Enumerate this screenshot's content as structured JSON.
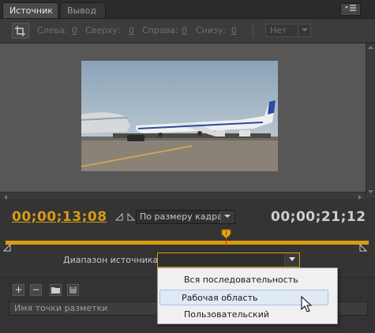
{
  "tabs": [
    {
      "label": "Источник",
      "active": true
    },
    {
      "label": "Вывод",
      "active": false
    }
  ],
  "crop": {
    "left_label": "Слева:",
    "left_value": "0",
    "top_label": "Сверху:",
    "top_value": "0",
    "right_label": "Справа:",
    "right_value": "0",
    "bottom_label": "Снизу:",
    "bottom_value": "0",
    "ratio_value": "Нет"
  },
  "playback": {
    "current_timecode": "00;00;13;08",
    "zoom_value": "По размеру кадра",
    "duration_timecode": "00;00;21;12"
  },
  "source_range": {
    "label": "Диапазон источника:",
    "value": "",
    "options": [
      "Вся последовательность",
      "Рабочая область",
      "Пользовательский"
    ],
    "hovered_index": 1
  },
  "markers": {
    "column_header": "Имя точки разметки"
  },
  "colors": {
    "accent": "#dc9c10",
    "timecode": "#d99b17",
    "playhead": "#d12a1a"
  }
}
